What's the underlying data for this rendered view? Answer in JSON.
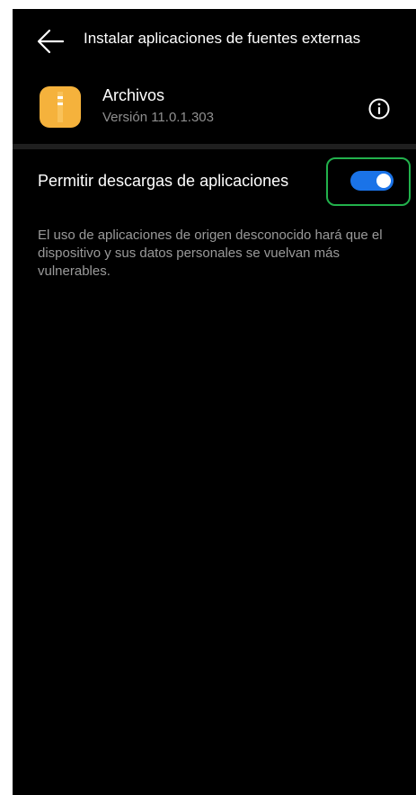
{
  "header": {
    "title": "Instalar aplicaciones de fuentes externas",
    "back_icon": "arrow-left-icon"
  },
  "app": {
    "name": "Archivos",
    "version": "Versión 11.0.1.303",
    "icon": "folder-zip-icon",
    "icon_color": "#f5b23c",
    "info_icon": "info-circle-icon"
  },
  "setting": {
    "label": "Permitir descargas de aplicaciones",
    "enabled": true,
    "toggle_color": "#1a73e8",
    "highlight_color": "#22b14c"
  },
  "warning_text": "El uso de aplicaciones de origen desconocido hará que el dispositivo y sus datos personales se vuelvan más vulnerables."
}
